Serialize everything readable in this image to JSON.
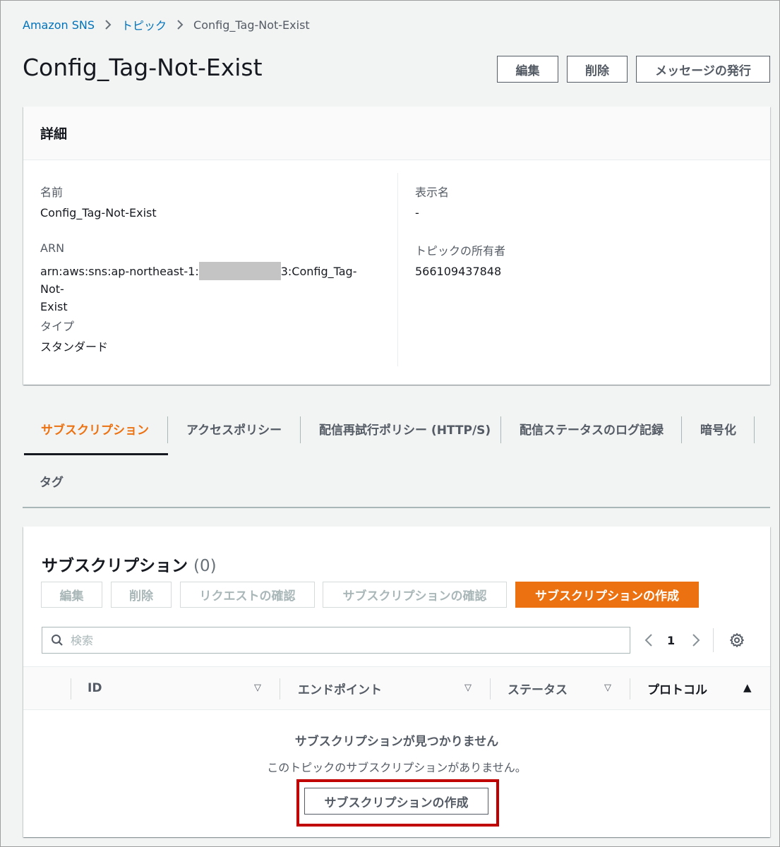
{
  "breadcrumb": {
    "root": "Amazon SNS",
    "topics": "トピック",
    "current": "Config_Tag-Not-Exist"
  },
  "header": {
    "title": "Config_Tag-Not-Exist",
    "edit_label": "編集",
    "delete_label": "削除",
    "publish_label": "メッセージの発行"
  },
  "details": {
    "heading": "詳細",
    "name_label": "名前",
    "name_value": "Config_Tag-Not-Exist",
    "arn_label": "ARN",
    "arn_prefix": "arn:aws:sns:ap-northeast-1:",
    "arn_suffix": "3:Config_Tag-Not-",
    "arn_suffix2": "Exist",
    "type_label": "タイプ",
    "type_value": "スタンダード",
    "display_name_label": "表示名",
    "display_name_value": "-",
    "owner_label": "トピックの所有者",
    "owner_value": "566109437848"
  },
  "tabs": {
    "subscriptions": "サブスクリプション",
    "access_policy": "アクセスポリシー",
    "retry_policy": "配信再試行ポリシー (HTTP/S)",
    "delivery_status": "配信ステータスのログ記録",
    "encryption": "暗号化",
    "tags": "タグ"
  },
  "subscriptions": {
    "title": "サブスクリプション",
    "count": "(0)",
    "edit_label": "編集",
    "delete_label": "削除",
    "request_confirm_label": "リクエストの確認",
    "confirm_label": "サブスクリプションの確認",
    "create_label": "サブスクリプションの作成",
    "search_placeholder": "検索",
    "page": "1",
    "columns": {
      "id": "ID",
      "endpoint": "エンドポイント",
      "status": "ステータス",
      "protocol": "プロトコル"
    },
    "empty_title": "サブスクリプションが見つかりません",
    "empty_desc": "このトピックのサブスクリプションがありません。",
    "empty_create_label": "サブスクリプションの作成"
  },
  "colors": {
    "accent": "#ec7211",
    "link": "#0073bb",
    "highlight": "#c00000"
  }
}
